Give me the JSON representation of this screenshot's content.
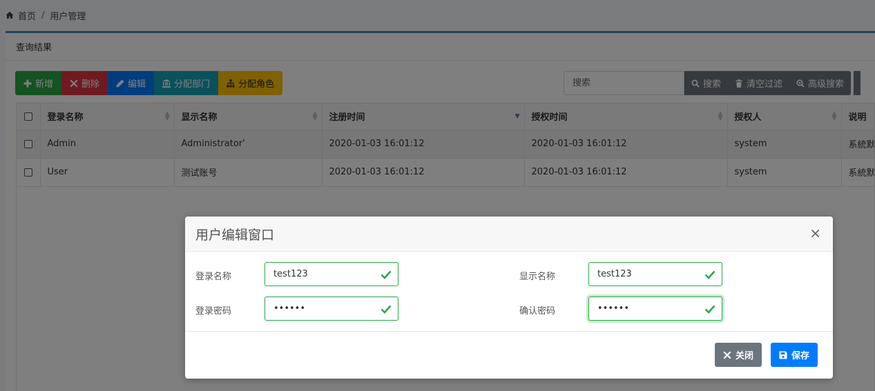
{
  "breadcrumb": {
    "home": "首页",
    "separator": "/",
    "current": "用户管理"
  },
  "card": {
    "title": "查询结果"
  },
  "toolbar": {
    "add": "新增",
    "delete": "删除",
    "edit": "编辑",
    "assign_dept": "分配部门",
    "assign_role": "分配角色"
  },
  "search": {
    "placeholder": "搜索",
    "search_btn": "搜索",
    "clear_btn": "清空过滤",
    "advanced_btn": "高级搜索"
  },
  "table": {
    "headers": [
      "登录名称",
      "显示名称",
      "注册时间",
      "授权时间",
      "授权人",
      "说明"
    ],
    "rows": [
      [
        "Admin",
        "Administrator'",
        "2020-01-03 16:01:12",
        "2020-01-03 16:01:12",
        "system",
        "系統默"
      ],
      [
        "User",
        "测试账号",
        "2020-01-03 16:01:12",
        "2020-01-03 16:01:12",
        "system",
        "系統默"
      ]
    ]
  },
  "modal": {
    "title": "用户编辑窗口",
    "close_x": "×",
    "fields": {
      "login_name": {
        "label": "登录名称",
        "value": "test123"
      },
      "display_name": {
        "label": "显示名称",
        "value": "test123"
      },
      "password": {
        "label": "登录密码",
        "value": "••••••"
      },
      "confirm_password": {
        "label": "确认密码",
        "value": "••••••"
      }
    },
    "close_btn": "关闭",
    "save_btn": "保存"
  },
  "colors": {
    "primary": "#007bff",
    "success": "#28a745",
    "danger": "#dc3545",
    "info": "#17a2b8",
    "warning": "#ffc107",
    "secondary": "#6c757d",
    "card_top": "#3c8dbc"
  }
}
